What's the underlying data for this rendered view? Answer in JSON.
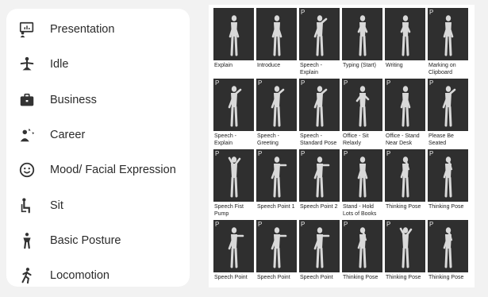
{
  "sidebar": {
    "items": [
      {
        "label": "Presentation",
        "icon": "presentation-icon"
      },
      {
        "label": "Idle",
        "icon": "idle-icon"
      },
      {
        "label": "Business",
        "icon": "briefcase-icon"
      },
      {
        "label": "Career",
        "icon": "career-icon"
      },
      {
        "label": "Mood/ Facial Expression",
        "icon": "smiley-icon"
      },
      {
        "label": "Sit",
        "icon": "sit-icon"
      },
      {
        "label": "Basic Posture",
        "icon": "posture-icon"
      },
      {
        "label": "Locomotion",
        "icon": "locomotion-icon"
      }
    ]
  },
  "poses": [
    {
      "caption": "Explain",
      "premium": false,
      "pose": "down"
    },
    {
      "caption": "Introduce",
      "premium": false,
      "pose": "down"
    },
    {
      "caption": "Speech - Explain",
      "premium": true,
      "pose": "oneup"
    },
    {
      "caption": "Typing (Start)",
      "premium": false,
      "pose": "sitfwd"
    },
    {
      "caption": "Writing",
      "premium": false,
      "pose": "sitfwd"
    },
    {
      "caption": "Marking on Clipboard",
      "premium": true,
      "pose": "down"
    },
    {
      "caption": "Speech - Explain",
      "premium": true,
      "pose": "oneup"
    },
    {
      "caption": "Speech - Greeting",
      "premium": true,
      "pose": "oneup"
    },
    {
      "caption": "Speech - Standard Pose",
      "premium": true,
      "pose": "oneup"
    },
    {
      "caption": "Office - Sit Relaxly",
      "premium": true,
      "pose": "lean"
    },
    {
      "caption": "Office - Stand Near Desk",
      "premium": true,
      "pose": "down"
    },
    {
      "caption": "Please Be Seated",
      "premium": true,
      "pose": "oneup"
    },
    {
      "caption": "Speech Fist Pump",
      "premium": true,
      "pose": "bothup"
    },
    {
      "caption": "Speech Point 1",
      "premium": true,
      "pose": "point"
    },
    {
      "caption": "Speech Point 2",
      "premium": true,
      "pose": "point"
    },
    {
      "caption": "Stand - Hold Lots of Books",
      "premium": true,
      "pose": "down"
    },
    {
      "caption": "Thinking Pose",
      "premium": true,
      "pose": "think"
    },
    {
      "caption": "Thinking Pose",
      "premium": true,
      "pose": "think"
    },
    {
      "caption": "Speech Point",
      "premium": true,
      "pose": "point"
    },
    {
      "caption": "Speech Point",
      "premium": true,
      "pose": "point"
    },
    {
      "caption": "Speech Point",
      "premium": true,
      "pose": "point"
    },
    {
      "caption": "Thinking Pose",
      "premium": true,
      "pose": "think"
    },
    {
      "caption": "Thinking Pose",
      "premium": true,
      "pose": "bothup"
    },
    {
      "caption": "Thinking Pose",
      "premium": true,
      "pose": "think"
    }
  ],
  "premium_badge": "P",
  "colors": {
    "thumb_bg": "#2f2f2f",
    "figure": "#d9d9d9",
    "sidebar_bg": "#ffffff",
    "page_bg": "#f2f2f2"
  }
}
